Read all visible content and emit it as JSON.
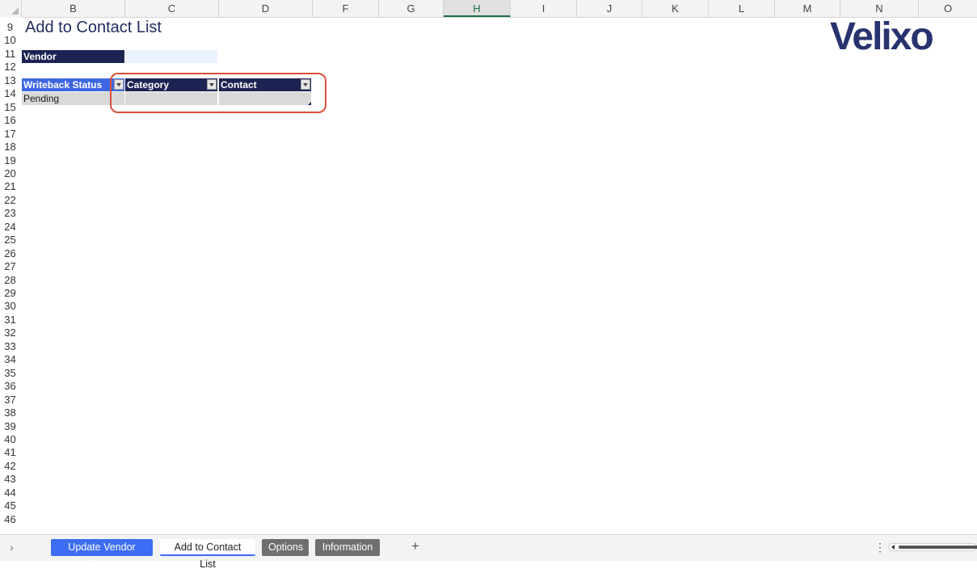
{
  "columns": [
    "B",
    "C",
    "D",
    "F",
    "G",
    "H",
    "I",
    "J",
    "K",
    "L",
    "M",
    "N",
    "O"
  ],
  "selected_column": "H",
  "rows": [
    "9",
    "10",
    "11",
    "12",
    "13",
    "14",
    "15",
    "16",
    "17",
    "18",
    "19",
    "20",
    "21",
    "22",
    "23",
    "24",
    "25",
    "26",
    "27",
    "28",
    "29",
    "30",
    "31",
    "32",
    "33",
    "34",
    "35",
    "36",
    "37",
    "38",
    "39",
    "40",
    "41",
    "42",
    "43",
    "44",
    "45",
    "46"
  ],
  "sheet": {
    "title": "Add to Contact List",
    "vendor_label": "Vendor",
    "vendor_value": "",
    "table_headers": [
      "Writeback Status",
      "Category",
      "Contact"
    ],
    "writeback_status": "Pending",
    "category_value": "",
    "contact_value": ""
  },
  "logo": "Velixo",
  "tabs": [
    {
      "label": "Update Vendor Data",
      "style": "blue"
    },
    {
      "label": "Add to Contact List",
      "style": "active"
    },
    {
      "label": "Options",
      "style": "gray"
    },
    {
      "label": "Information",
      "style": "gray"
    }
  ],
  "icons": {
    "nav": "chevron-right-icon",
    "add_sheet": "plus-icon",
    "more": "more-vertical-icon",
    "filter": "dropdown-arrow-icon"
  },
  "glyphs": {
    "nav": "›",
    "add": "+",
    "more": "⋮"
  },
  "colors": {
    "header_navy": "#1b2452",
    "header_blue": "#3d67e2",
    "callout": "#d9503a",
    "logo": "#27336e",
    "tab_blue": "#3d6df2",
    "tab_gray": "#6f6f6f"
  }
}
